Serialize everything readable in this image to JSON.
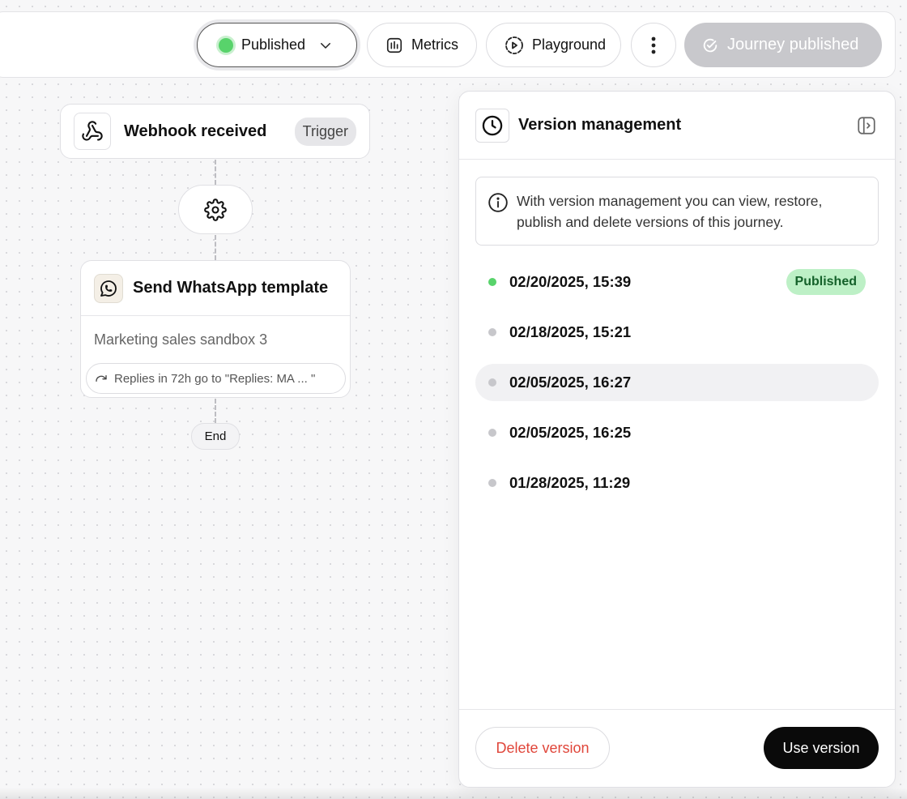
{
  "toolbar": {
    "status_label": "Published",
    "metrics_label": "Metrics",
    "playground_label": "Playground",
    "journey_published_label": "Journey published"
  },
  "canvas": {
    "trigger": {
      "title": "Webhook received",
      "badge": "Trigger"
    },
    "action": {
      "title": "Send WhatsApp template",
      "subtitle": "Marketing sales sandbox 3",
      "reply_route": "Replies in 72h go to \"Replies: MA ... \""
    },
    "end_label": "End"
  },
  "panel": {
    "title": "Version management",
    "info": "With version management you can view, restore, publish and delete versions of this journey.",
    "versions": [
      {
        "date": "02/20/2025, 15:39",
        "badge": "Published",
        "live": true
      },
      {
        "date": "02/18/2025, 15:21"
      },
      {
        "date": "02/05/2025, 16:27",
        "hovered": true
      },
      {
        "date": "02/05/2025, 16:25"
      },
      {
        "date": "01/28/2025, 11:29"
      }
    ],
    "delete_label": "Delete version",
    "use_label": "Use version"
  },
  "colors": {
    "live": "#58d36b",
    "danger": "#e0463a",
    "primary_button": "#0a0a0a",
    "disabled_button": "#c8c8cc"
  }
}
